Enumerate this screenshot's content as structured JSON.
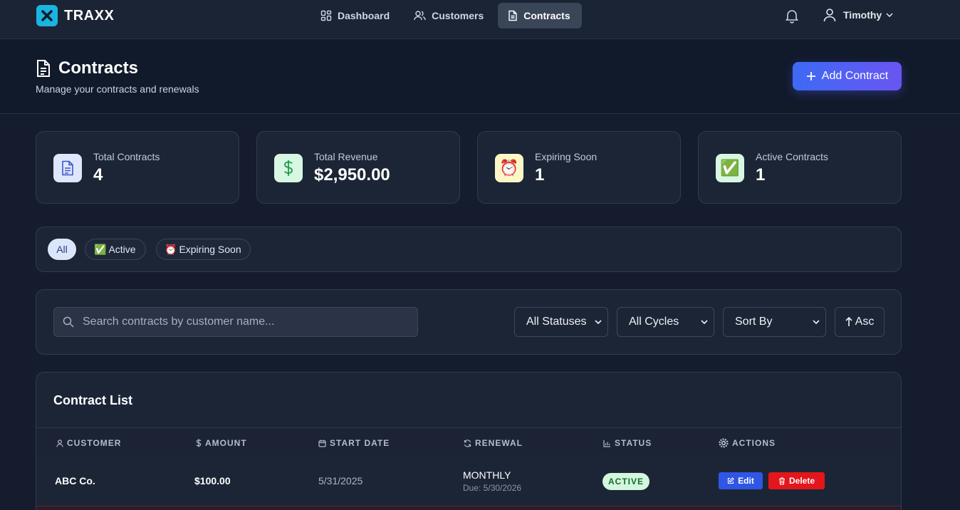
{
  "app": {
    "name": "TRAXX"
  },
  "nav": {
    "items": [
      {
        "label": "Dashboard",
        "icon": "dashboard-grid-icon"
      },
      {
        "label": "Customers",
        "icon": "users-icon"
      },
      {
        "label": "Contracts",
        "icon": "document-icon",
        "active": true
      }
    ]
  },
  "user": {
    "name": "Timothy"
  },
  "page": {
    "title": "Contracts",
    "subtitle": "Manage your contracts and renewals",
    "add_button": "Add Contract"
  },
  "stats": [
    {
      "label": "Total Contracts",
      "value": "4",
      "icon": "document-icon",
      "color": "#3a57c9"
    },
    {
      "label": "Total Revenue",
      "value": "$2,950.00",
      "icon": "dollar-icon",
      "color": "#1c9a4b"
    },
    {
      "label": "Expiring Soon",
      "value": "1",
      "icon": "⏰",
      "color": "#fdf7c7"
    },
    {
      "label": "Active Contracts",
      "value": "1",
      "icon": "✅",
      "color": "#d8f7e3"
    }
  ],
  "filter_tabs": {
    "all": "All",
    "active": "Active",
    "expiring": "Expiring Soon",
    "active_emoji": "✅",
    "expiring_emoji": "⏰"
  },
  "filters": {
    "search_placeholder": "Search contracts by customer name...",
    "status": "All Statuses",
    "cycle": "All Cycles",
    "sort": "Sort By",
    "order": "Asc"
  },
  "table": {
    "title": "Contract List",
    "columns": {
      "customer": "CUSTOMER",
      "amount": "AMOUNT",
      "start": "START DATE",
      "renewal": "RENEWAL",
      "status": "STATUS",
      "actions": "ACTIONS"
    },
    "rows": [
      {
        "customer": "ABC Co.",
        "amount": "$100.00",
        "start_date": "5/31/2025",
        "renewal": "MONTHLY",
        "due": "Due: 5/30/2026",
        "status": "ACTIVE",
        "edit": "Edit",
        "delete": "Delete"
      }
    ]
  },
  "colors": {
    "accent": "#3d6af5",
    "background": "#141c2e",
    "card": "#1c2536",
    "success": "#166b35",
    "danger": "#e3161c"
  }
}
